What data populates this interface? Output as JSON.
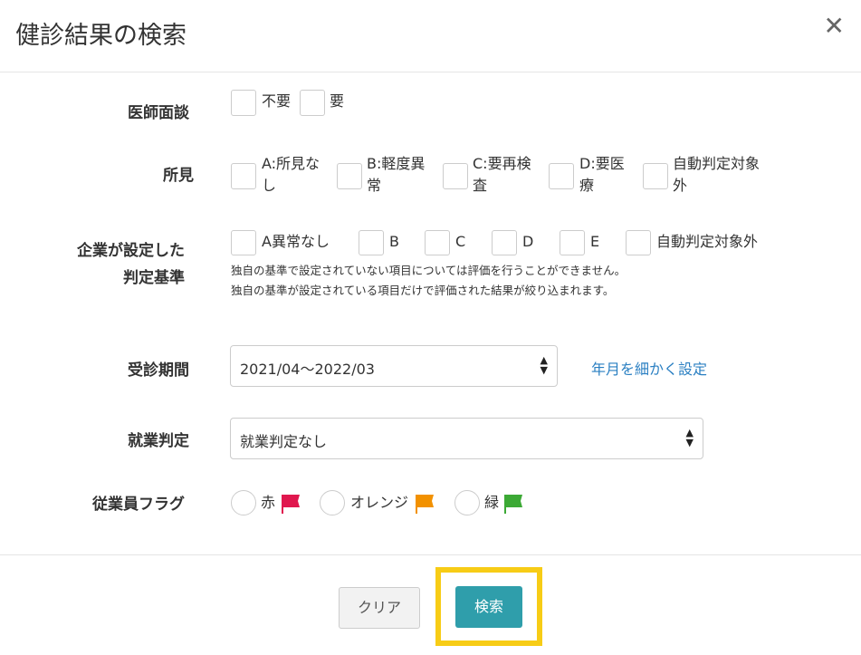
{
  "dialog": {
    "title": "健診結果の検索"
  },
  "doctor_interview": {
    "label": "医師面談",
    "options": [
      "不要",
      "要"
    ]
  },
  "findings": {
    "label": "所見",
    "options": [
      {
        "line1": "A:所見な",
        "line2": "し"
      },
      {
        "line1": "B:軽度異",
        "line2": "常"
      },
      {
        "line1": "C:要再検",
        "line2": "査"
      },
      {
        "line1": "D:要医",
        "line2": "療"
      },
      {
        "line1": "自動判定対象",
        "line2": "外"
      }
    ]
  },
  "company_criteria": {
    "label_line1": "企業が設定した",
    "label_line2": "判定基準",
    "options": [
      "A異常なし",
      "B",
      "C",
      "D",
      "E",
      "自動判定対象外"
    ],
    "note1": "独自の基準で設定されていない項目については評価を行うことができません。",
    "note2": "独自の基準が設定されている項目だけで評価された結果が絞り込まれます。"
  },
  "exam_period": {
    "label": "受診期間",
    "value": "2021/04～2022/03",
    "link": "年月を細かく設定"
  },
  "work_judgment": {
    "label": "就業判定",
    "value": "就業判定なし"
  },
  "employee_flag": {
    "label": "従業員フラグ",
    "options": [
      {
        "label": "赤",
        "color": "#e0174e",
        "icon": "flag-icon"
      },
      {
        "label": "オレンジ",
        "color": "#f29100",
        "icon": "flag-icon"
      },
      {
        "label": "緑",
        "color": "#3ca935",
        "icon": "flag-icon"
      }
    ]
  },
  "footer": {
    "clear_label": "クリア",
    "search_label": "検索"
  },
  "colors": {
    "primary": "#2f9eab",
    "highlight": "#f7cc16",
    "link": "#2a7fc2"
  }
}
